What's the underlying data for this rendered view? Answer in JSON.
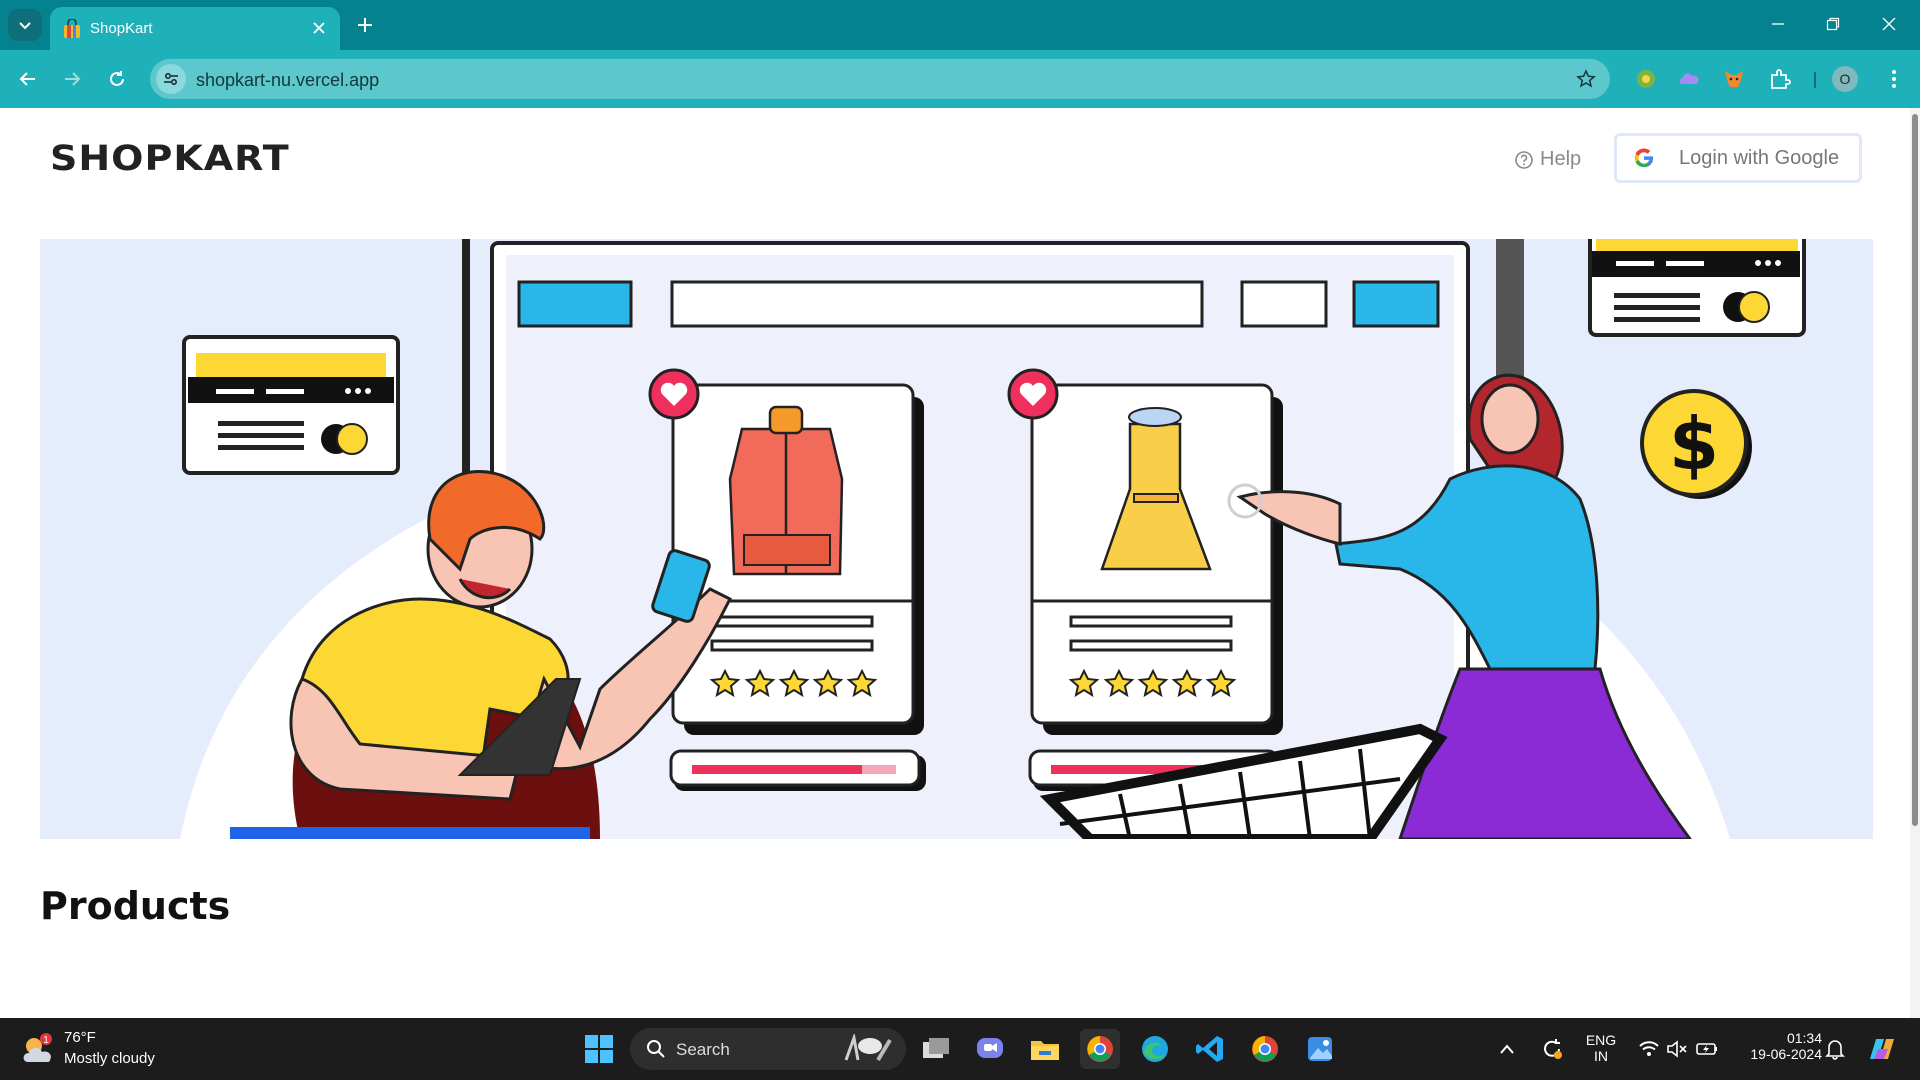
{
  "browser": {
    "tab_title": "ShopKart",
    "url": "shopkart-nu.vercel.app",
    "profile_initial": "O"
  },
  "header": {
    "logo": "SHOPKART",
    "help_label": "Help",
    "login_label": "Login with Google"
  },
  "main": {
    "section_title": "Products"
  },
  "taskbar": {
    "weather_temp": "76°F",
    "weather_condition": "Mostly cloudy",
    "weather_badge": "1",
    "search_label": "Search",
    "language_line1": "ENG",
    "language_line2": "IN",
    "time": "01:34",
    "date": "19-06-2024"
  },
  "colors": {
    "chrome_tab_strip": "#04828f",
    "chrome_toolbar": "#1fb1b9",
    "banner_bg": "#e5ecfb",
    "accent_yellow": "#fdd835",
    "accent_blue": "#29b6e8",
    "accent_pink": "#ef2f5c"
  }
}
